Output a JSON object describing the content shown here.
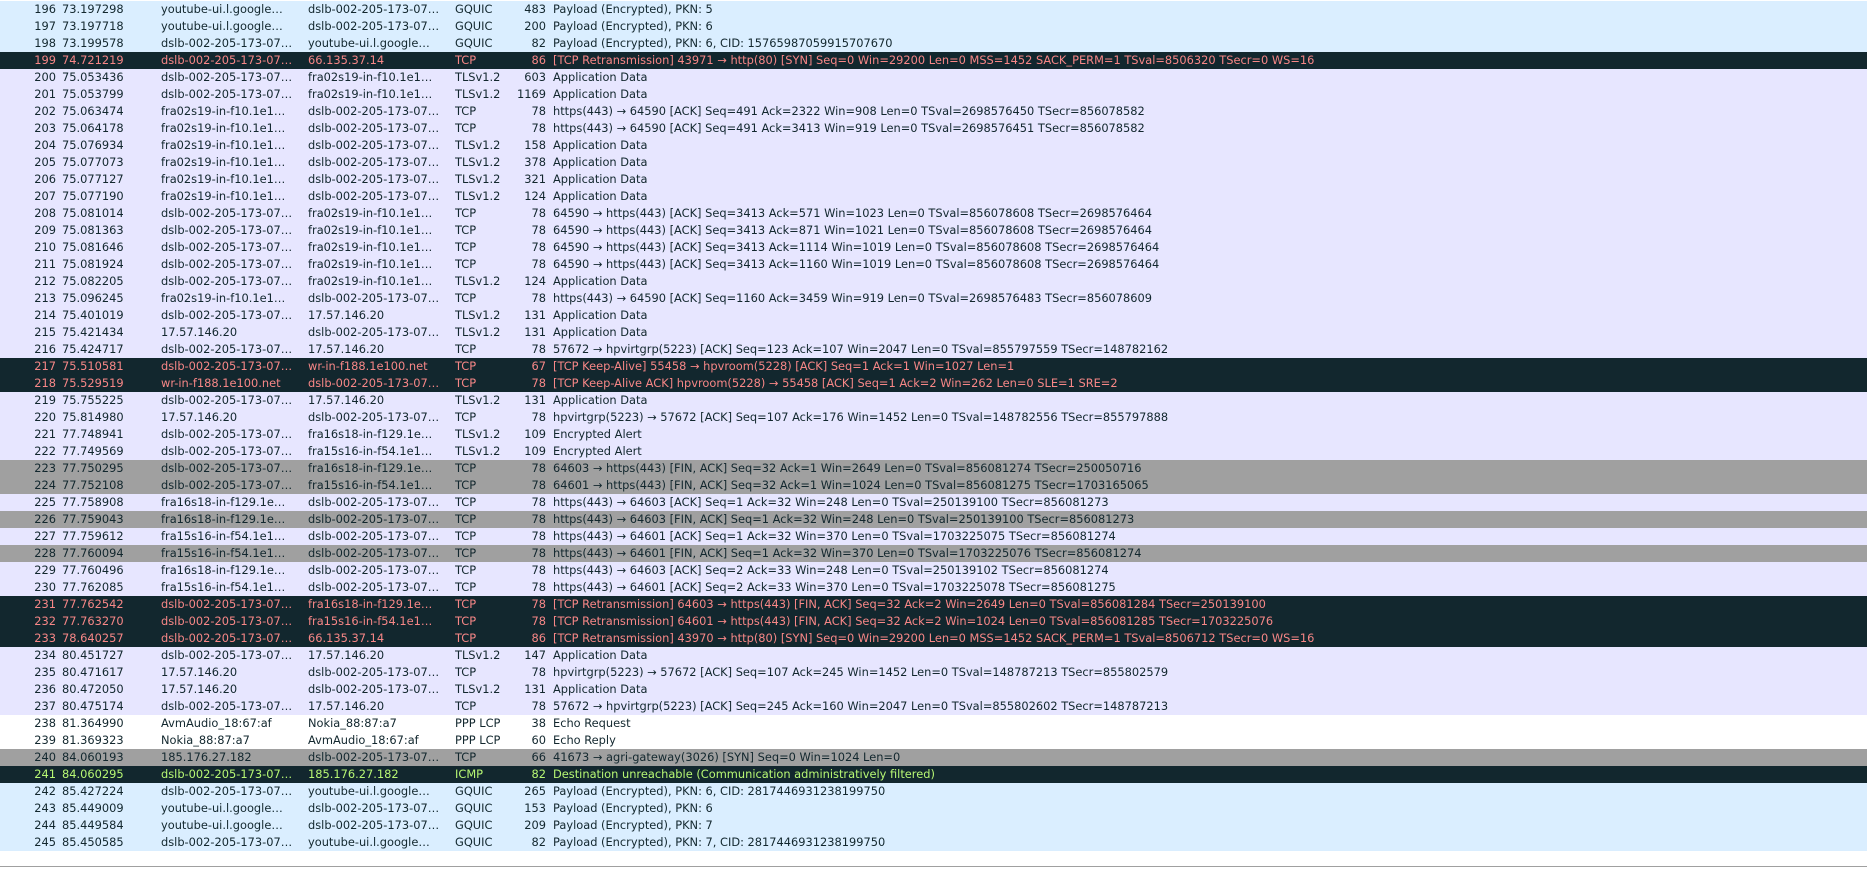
{
  "colors": {
    "quic": "#daeeff",
    "tcp": "#e7e6ff",
    "bad": "#12272e",
    "bad_text": "#f78787",
    "finsyn": "#a0a0a0",
    "ppp": "#ffffff",
    "text": "#12272e"
  },
  "packets": [
    {
      "no": "196",
      "time": "73.197298",
      "src": "youtube-ui.l.google…",
      "dst": "dslb-002-205-173-07…",
      "proto": "GQUIC",
      "len": "483",
      "info": "Payload (Encrypted), PKN: 5",
      "style": "quic"
    },
    {
      "no": "197",
      "time": "73.197718",
      "src": "youtube-ui.l.google…",
      "dst": "dslb-002-205-173-07…",
      "proto": "GQUIC",
      "len": "200",
      "info": "Payload (Encrypted), PKN: 6",
      "style": "quic"
    },
    {
      "no": "198",
      "time": "73.199578",
      "src": "dslb-002-205-173-07…",
      "dst": "youtube-ui.l.google…",
      "proto": "GQUIC",
      "len": "82",
      "info": "Payload (Encrypted), PKN: 6, CID: 15765987059915707670",
      "style": "quic"
    },
    {
      "no": "199",
      "time": "74.721219",
      "src": "dslb-002-205-173-07…",
      "dst": "66.135.37.14",
      "proto": "TCP",
      "len": "86",
      "info": "[TCP Retransmission] 43971 → http(80) [SYN] Seq=0 Win=29200 Len=0 MSS=1452 SACK_PERM=1 TSval=8506320 TSecr=0 WS=16",
      "style": "bad"
    },
    {
      "no": "200",
      "time": "75.053436",
      "src": "dslb-002-205-173-07…",
      "dst": "fra02s19-in-f10.1e1…",
      "proto": "TLSv1.2",
      "len": "603",
      "info": "Application Data",
      "style": "tcp"
    },
    {
      "no": "201",
      "time": "75.053799",
      "src": "dslb-002-205-173-07…",
      "dst": "fra02s19-in-f10.1e1…",
      "proto": "TLSv1.2",
      "len": "1169",
      "info": "Application Data",
      "style": "tcp"
    },
    {
      "no": "202",
      "time": "75.063474",
      "src": "fra02s19-in-f10.1e1…",
      "dst": "dslb-002-205-173-07…",
      "proto": "TCP",
      "len": "78",
      "info": "https(443) → 64590 [ACK] Seq=491 Ack=2322 Win=908 Len=0 TSval=2698576450 TSecr=856078582",
      "style": "tcp"
    },
    {
      "no": "203",
      "time": "75.064178",
      "src": "fra02s19-in-f10.1e1…",
      "dst": "dslb-002-205-173-07…",
      "proto": "TCP",
      "len": "78",
      "info": "https(443) → 64590 [ACK] Seq=491 Ack=3413 Win=919 Len=0 TSval=2698576451 TSecr=856078582",
      "style": "tcp"
    },
    {
      "no": "204",
      "time": "75.076934",
      "src": "fra02s19-in-f10.1e1…",
      "dst": "dslb-002-205-173-07…",
      "proto": "TLSv1.2",
      "len": "158",
      "info": "Application Data",
      "style": "tcp"
    },
    {
      "no": "205",
      "time": "75.077073",
      "src": "fra02s19-in-f10.1e1…",
      "dst": "dslb-002-205-173-07…",
      "proto": "TLSv1.2",
      "len": "378",
      "info": "Application Data",
      "style": "tcp"
    },
    {
      "no": "206",
      "time": "75.077127",
      "src": "fra02s19-in-f10.1e1…",
      "dst": "dslb-002-205-173-07…",
      "proto": "TLSv1.2",
      "len": "321",
      "info": "Application Data",
      "style": "tcp"
    },
    {
      "no": "207",
      "time": "75.077190",
      "src": "fra02s19-in-f10.1e1…",
      "dst": "dslb-002-205-173-07…",
      "proto": "TLSv1.2",
      "len": "124",
      "info": "Application Data",
      "style": "tcp"
    },
    {
      "no": "208",
      "time": "75.081014",
      "src": "dslb-002-205-173-07…",
      "dst": "fra02s19-in-f10.1e1…",
      "proto": "TCP",
      "len": "78",
      "info": "64590 → https(443) [ACK] Seq=3413 Ack=571 Win=1023 Len=0 TSval=856078608 TSecr=2698576464",
      "style": "tcp"
    },
    {
      "no": "209",
      "time": "75.081363",
      "src": "dslb-002-205-173-07…",
      "dst": "fra02s19-in-f10.1e1…",
      "proto": "TCP",
      "len": "78",
      "info": "64590 → https(443) [ACK] Seq=3413 Ack=871 Win=1021 Len=0 TSval=856078608 TSecr=2698576464",
      "style": "tcp"
    },
    {
      "no": "210",
      "time": "75.081646",
      "src": "dslb-002-205-173-07…",
      "dst": "fra02s19-in-f10.1e1…",
      "proto": "TCP",
      "len": "78",
      "info": "64590 → https(443) [ACK] Seq=3413 Ack=1114 Win=1019 Len=0 TSval=856078608 TSecr=2698576464",
      "style": "tcp"
    },
    {
      "no": "211",
      "time": "75.081924",
      "src": "dslb-002-205-173-07…",
      "dst": "fra02s19-in-f10.1e1…",
      "proto": "TCP",
      "len": "78",
      "info": "64590 → https(443) [ACK] Seq=3413 Ack=1160 Win=1019 Len=0 TSval=856078608 TSecr=2698576464",
      "style": "tcp"
    },
    {
      "no": "212",
      "time": "75.082205",
      "src": "dslb-002-205-173-07…",
      "dst": "fra02s19-in-f10.1e1…",
      "proto": "TLSv1.2",
      "len": "124",
      "info": "Application Data",
      "style": "tcp"
    },
    {
      "no": "213",
      "time": "75.096245",
      "src": "fra02s19-in-f10.1e1…",
      "dst": "dslb-002-205-173-07…",
      "proto": "TCP",
      "len": "78",
      "info": "https(443) → 64590 [ACK] Seq=1160 Ack=3459 Win=919 Len=0 TSval=2698576483 TSecr=856078609",
      "style": "tcp"
    },
    {
      "no": "214",
      "time": "75.401019",
      "src": "dslb-002-205-173-07…",
      "dst": "17.57.146.20",
      "proto": "TLSv1.2",
      "len": "131",
      "info": "Application Data",
      "style": "tcp"
    },
    {
      "no": "215",
      "time": "75.421434",
      "src": "17.57.146.20",
      "dst": "dslb-002-205-173-07…",
      "proto": "TLSv1.2",
      "len": "131",
      "info": "Application Data",
      "style": "tcp"
    },
    {
      "no": "216",
      "time": "75.424717",
      "src": "dslb-002-205-173-07…",
      "dst": "17.57.146.20",
      "proto": "TCP",
      "len": "78",
      "info": "57672 → hpvirtgrp(5223) [ACK] Seq=123 Ack=107 Win=2047 Len=0 TSval=855797559 TSecr=148782162",
      "style": "tcp"
    },
    {
      "no": "217",
      "time": "75.510581",
      "src": "dslb-002-205-173-07…",
      "dst": "wr-in-f188.1e100.net",
      "proto": "TCP",
      "len": "67",
      "info": "[TCP Keep-Alive] 55458 → hpvroom(5228) [ACK] Seq=1 Ack=1 Win=1027 Len=1",
      "style": "bad"
    },
    {
      "no": "218",
      "time": "75.529519",
      "src": "wr-in-f188.1e100.net",
      "dst": "dslb-002-205-173-07…",
      "proto": "TCP",
      "len": "78",
      "info": "[TCP Keep-Alive ACK] hpvroom(5228) → 55458 [ACK] Seq=1 Ack=2 Win=262 Len=0 SLE=1 SRE=2",
      "style": "bad"
    },
    {
      "no": "219",
      "time": "75.755225",
      "src": "dslb-002-205-173-07…",
      "dst": "17.57.146.20",
      "proto": "TLSv1.2",
      "len": "131",
      "info": "Application Data",
      "style": "tcp"
    },
    {
      "no": "220",
      "time": "75.814980",
      "src": "17.57.146.20",
      "dst": "dslb-002-205-173-07…",
      "proto": "TCP",
      "len": "78",
      "info": "hpvirtgrp(5223) → 57672 [ACK] Seq=107 Ack=176 Win=1452 Len=0 TSval=148782556 TSecr=855797888",
      "style": "tcp"
    },
    {
      "no": "221",
      "time": "77.748941",
      "src": "dslb-002-205-173-07…",
      "dst": "fra16s18-in-f129.1e…",
      "proto": "TLSv1.2",
      "len": "109",
      "info": "Encrypted Alert",
      "style": "tcp"
    },
    {
      "no": "222",
      "time": "77.749569",
      "src": "dslb-002-205-173-07…",
      "dst": "fra15s16-in-f54.1e1…",
      "proto": "TLSv1.2",
      "len": "109",
      "info": "Encrypted Alert",
      "style": "tcp"
    },
    {
      "no": "223",
      "time": "77.750295",
      "src": "dslb-002-205-173-07…",
      "dst": "fra16s18-in-f129.1e…",
      "proto": "TCP",
      "len": "78",
      "info": "64603 → https(443) [FIN, ACK] Seq=32 Ack=1 Win=2649 Len=0 TSval=856081274 TSecr=250050716",
      "style": "finsyn"
    },
    {
      "no": "224",
      "time": "77.752108",
      "src": "dslb-002-205-173-07…",
      "dst": "fra15s16-in-f54.1e1…",
      "proto": "TCP",
      "len": "78",
      "info": "64601 → https(443) [FIN, ACK] Seq=32 Ack=1 Win=1024 Len=0 TSval=856081275 TSecr=1703165065",
      "style": "finsyn"
    },
    {
      "no": "225",
      "time": "77.758908",
      "src": "fra16s18-in-f129.1e…",
      "dst": "dslb-002-205-173-07…",
      "proto": "TCP",
      "len": "78",
      "info": "https(443) → 64603 [ACK] Seq=1 Ack=32 Win=248 Len=0 TSval=250139100 TSecr=856081273",
      "style": "tcp"
    },
    {
      "no": "226",
      "time": "77.759043",
      "src": "fra16s18-in-f129.1e…",
      "dst": "dslb-002-205-173-07…",
      "proto": "TCP",
      "len": "78",
      "info": "https(443) → 64603 [FIN, ACK] Seq=1 Ack=32 Win=248 Len=0 TSval=250139100 TSecr=856081273",
      "style": "finsyn"
    },
    {
      "no": "227",
      "time": "77.759612",
      "src": "fra15s16-in-f54.1e1…",
      "dst": "dslb-002-205-173-07…",
      "proto": "TCP",
      "len": "78",
      "info": "https(443) → 64601 [ACK] Seq=1 Ack=32 Win=370 Len=0 TSval=1703225075 TSecr=856081274",
      "style": "tcp"
    },
    {
      "no": "228",
      "time": "77.760094",
      "src": "fra15s16-in-f54.1e1…",
      "dst": "dslb-002-205-173-07…",
      "proto": "TCP",
      "len": "78",
      "info": "https(443) → 64601 [FIN, ACK] Seq=1 Ack=32 Win=370 Len=0 TSval=1703225076 TSecr=856081274",
      "style": "finsyn"
    },
    {
      "no": "229",
      "time": "77.760496",
      "src": "fra16s18-in-f129.1e…",
      "dst": "dslb-002-205-173-07…",
      "proto": "TCP",
      "len": "78",
      "info": "https(443) → 64603 [ACK] Seq=2 Ack=33 Win=248 Len=0 TSval=250139102 TSecr=856081274",
      "style": "tcp"
    },
    {
      "no": "230",
      "time": "77.762085",
      "src": "fra15s16-in-f54.1e1…",
      "dst": "dslb-002-205-173-07…",
      "proto": "TCP",
      "len": "78",
      "info": "https(443) → 64601 [ACK] Seq=2 Ack=33 Win=370 Len=0 TSval=1703225078 TSecr=856081275",
      "style": "tcp"
    },
    {
      "no": "231",
      "time": "77.762542",
      "src": "dslb-002-205-173-07…",
      "dst": "fra16s18-in-f129.1e…",
      "proto": "TCP",
      "len": "78",
      "info": "[TCP Retransmission] 64603 → https(443) [FIN, ACK] Seq=32 Ack=2 Win=2649 Len=0 TSval=856081284 TSecr=250139100",
      "style": "bad"
    },
    {
      "no": "232",
      "time": "77.763270",
      "src": "dslb-002-205-173-07…",
      "dst": "fra15s16-in-f54.1e1…",
      "proto": "TCP",
      "len": "78",
      "info": "[TCP Retransmission] 64601 → https(443) [FIN, ACK] Seq=32 Ack=2 Win=1024 Len=0 TSval=856081285 TSecr=1703225076",
      "style": "bad"
    },
    {
      "no": "233",
      "time": "78.640257",
      "src": "dslb-002-205-173-07…",
      "dst": "66.135.37.14",
      "proto": "TCP",
      "len": "86",
      "info": "[TCP Retransmission] 43970 → http(80) [SYN] Seq=0 Win=29200 Len=0 MSS=1452 SACK_PERM=1 TSval=8506712 TSecr=0 WS=16",
      "style": "bad"
    },
    {
      "no": "234",
      "time": "80.451727",
      "src": "dslb-002-205-173-07…",
      "dst": "17.57.146.20",
      "proto": "TLSv1.2",
      "len": "147",
      "info": "Application Data",
      "style": "tcp"
    },
    {
      "no": "235",
      "time": "80.471617",
      "src": "17.57.146.20",
      "dst": "dslb-002-205-173-07…",
      "proto": "TCP",
      "len": "78",
      "info": "hpvirtgrp(5223) → 57672 [ACK] Seq=107 Ack=245 Win=1452 Len=0 TSval=148787213 TSecr=855802579",
      "style": "tcp"
    },
    {
      "no": "236",
      "time": "80.472050",
      "src": "17.57.146.20",
      "dst": "dslb-002-205-173-07…",
      "proto": "TLSv1.2",
      "len": "131",
      "info": "Application Data",
      "style": "tcp"
    },
    {
      "no": "237",
      "time": "80.475174",
      "src": "dslb-002-205-173-07…",
      "dst": "17.57.146.20",
      "proto": "TCP",
      "len": "78",
      "info": "57672 → hpvirtgrp(5223) [ACK] Seq=245 Ack=160 Win=2047 Len=0 TSval=855802602 TSecr=148787213",
      "style": "tcp"
    },
    {
      "no": "238",
      "time": "81.364990",
      "src": "AvmAudio_18:67:af",
      "dst": "Nokia_88:87:a7",
      "proto": "PPP LCP",
      "len": "38",
      "info": "Echo Request",
      "style": "ppp"
    },
    {
      "no": "239",
      "time": "81.369323",
      "src": "Nokia_88:87:a7",
      "dst": "AvmAudio_18:67:af",
      "proto": "PPP LCP",
      "len": "60",
      "info": "Echo Reply",
      "style": "ppp"
    },
    {
      "no": "240",
      "time": "84.060193",
      "src": "185.176.27.182",
      "dst": "dslb-002-205-173-07…",
      "proto": "TCP",
      "len": "66",
      "info": "41673 → agri-gateway(3026) [SYN] Seq=0 Win=1024 Len=0",
      "style": "finsyn"
    },
    {
      "no": "241",
      "time": "84.060295",
      "src": "dslb-002-205-173-07…",
      "dst": "185.176.27.182",
      "proto": "ICMP",
      "len": "82",
      "info": "Destination unreachable (Communication administratively filtered)",
      "style": "icmp"
    },
    {
      "no": "242",
      "time": "85.427224",
      "src": "dslb-002-205-173-07…",
      "dst": "youtube-ui.l.google…",
      "proto": "GQUIC",
      "len": "265",
      "info": "Payload (Encrypted), PKN: 6, CID: 2817446931238199750",
      "style": "quic"
    },
    {
      "no": "243",
      "time": "85.449009",
      "src": "youtube-ui.l.google…",
      "dst": "dslb-002-205-173-07…",
      "proto": "GQUIC",
      "len": "153",
      "info": "Payload (Encrypted), PKN: 6",
      "style": "quic"
    },
    {
      "no": "244",
      "time": "85.449584",
      "src": "youtube-ui.l.google…",
      "dst": "dslb-002-205-173-07…",
      "proto": "GQUIC",
      "len": "209",
      "info": "Payload (Encrypted), PKN: 7",
      "style": "quic"
    },
    {
      "no": "245",
      "time": "85.450585",
      "src": "dslb-002-205-173-07…",
      "dst": "youtube-ui.l.google…",
      "proto": "GQUIC",
      "len": "82",
      "info": "Payload (Encrypted), PKN: 7, CID: 2817446931238199750",
      "style": "quic"
    }
  ]
}
